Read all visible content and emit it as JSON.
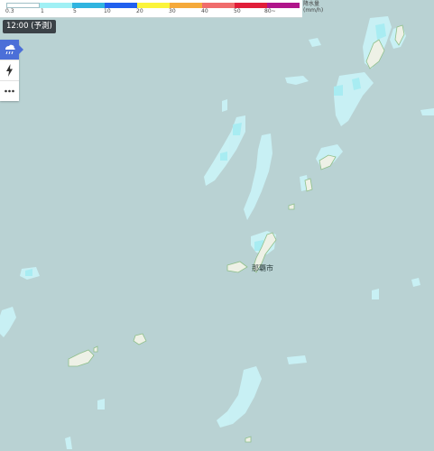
{
  "legend": {
    "labels": [
      "0.3",
      "1",
      "5",
      "10",
      "20",
      "30",
      "40",
      "50",
      "80~"
    ],
    "unit_line1": "降水量",
    "unit_line2": "(mm/h)",
    "colors": [
      "#ffffff",
      "#a0f0f5",
      "#30b4e0",
      "#2160ee",
      "#fbf43a",
      "#f5a93a",
      "#f06c6c",
      "#e11e39",
      "#b0158a"
    ]
  },
  "time_badge": "12:00 (予測)",
  "controls": [
    {
      "name": "rain-cloud-icon",
      "active": true
    },
    {
      "name": "lightning-icon",
      "active": false
    },
    {
      "name": "more-icon",
      "active": false
    }
  ],
  "map_labels": {
    "city": "那覇市"
  },
  "colors": {
    "sea": "#b9d2d3",
    "land": "#eef1e6",
    "coast": "#8fbf8a",
    "rain_light": "#c9f2f6",
    "rain_mid": "#a8ecf2"
  }
}
